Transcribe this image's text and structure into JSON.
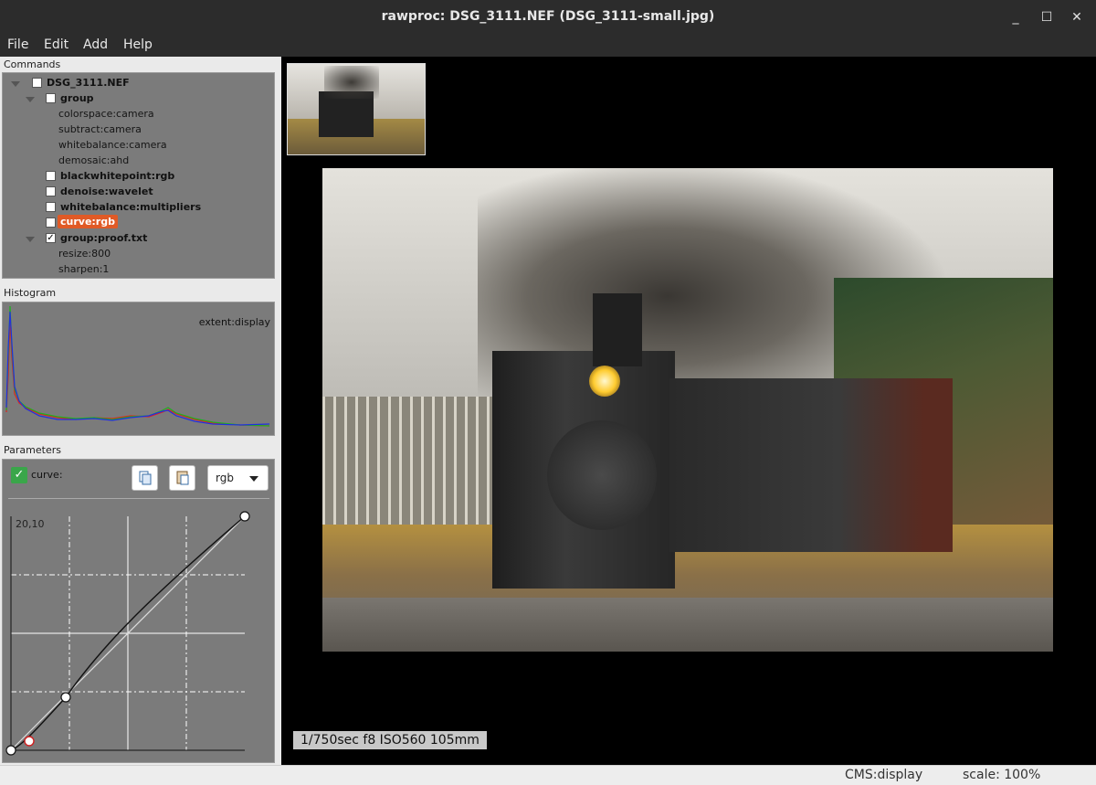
{
  "window": {
    "title": "rawproc: DSG_3111.NEF (DSG_3111-small.jpg)",
    "minimize": "_",
    "maximize": "☐",
    "close": "✕"
  },
  "menu": [
    "File",
    "Edit",
    "Add",
    "Help"
  ],
  "commands": {
    "label": "Commands",
    "items": [
      {
        "text": "DSG_3111.NEF",
        "bold": true,
        "checked": false
      },
      {
        "text": "group",
        "bold": true,
        "checked": false
      },
      {
        "text": "colorspace:camera"
      },
      {
        "text": "subtract:camera"
      },
      {
        "text": "whitebalance:camera"
      },
      {
        "text": "demosaic:ahd"
      },
      {
        "text": "blackwhitepoint:rgb",
        "bold": true,
        "checked": false
      },
      {
        "text": "denoise:wavelet",
        "bold": true,
        "checked": false
      },
      {
        "text": "whitebalance:multipliers",
        "bold": true,
        "checked": false
      },
      {
        "text": "curve:rgb",
        "bold": true,
        "checked": false,
        "selected": true
      },
      {
        "text": "group:proof.txt",
        "bold": true,
        "checked": true
      },
      {
        "text": "resize:800"
      },
      {
        "text": "sharpen:1"
      }
    ]
  },
  "histogram": {
    "label": "Histogram",
    "extent": "extent:display"
  },
  "parameters": {
    "label": "Parameters",
    "curve_label": "curve:",
    "channel": "rgb",
    "coord_readout": "20,10",
    "curve_points": [
      [
        0,
        0
      ],
      [
        20,
        10
      ],
      [
        64,
        64
      ],
      [
        255,
        255
      ]
    ]
  },
  "viewer": {
    "exif": "1/750sec f8 ISO560 105mm"
  },
  "status": {
    "cms": "CMS:display",
    "scale": "scale: 100%"
  },
  "colors": {
    "accent": "#e05a26",
    "checkbox_green": "#3aa64a"
  }
}
